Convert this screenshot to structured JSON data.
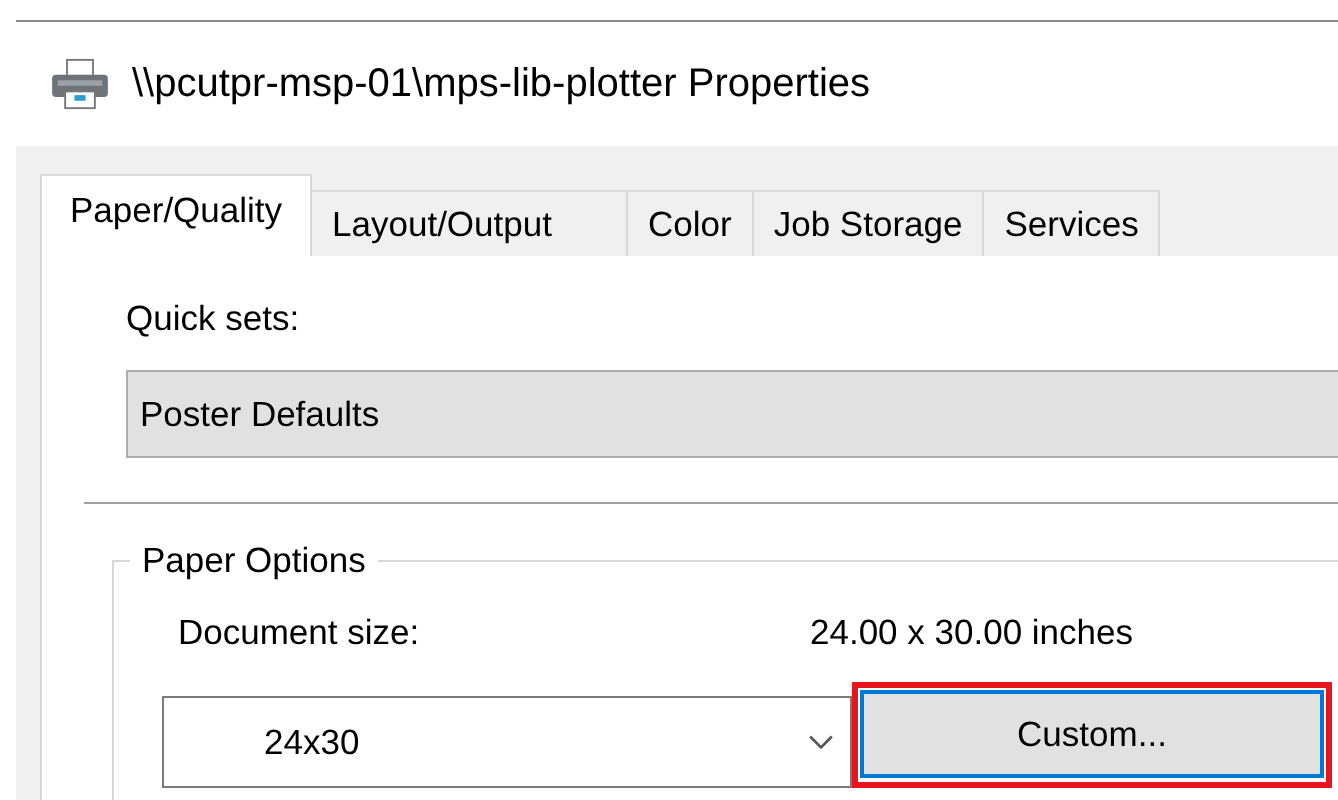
{
  "window": {
    "title": "\\\\pcutpr-msp-01\\mps-lib-plotter Properties"
  },
  "tabs": [
    {
      "label": "Paper/Quality",
      "selected": true
    },
    {
      "label": "Layout/Output",
      "selected": false
    },
    {
      "label": "Color",
      "selected": false
    },
    {
      "label": "Job Storage",
      "selected": false
    },
    {
      "label": "Services",
      "selected": false
    }
  ],
  "quick_sets": {
    "label": "Quick sets:",
    "value": "Poster Defaults"
  },
  "paper_options": {
    "title": "Paper Options",
    "document_size_label": "Document size:",
    "document_size_value": "24.00 x 30.00 inches",
    "size_select": "24x30",
    "custom_button": {
      "label": "Custom...",
      "highlighted": true
    }
  }
}
